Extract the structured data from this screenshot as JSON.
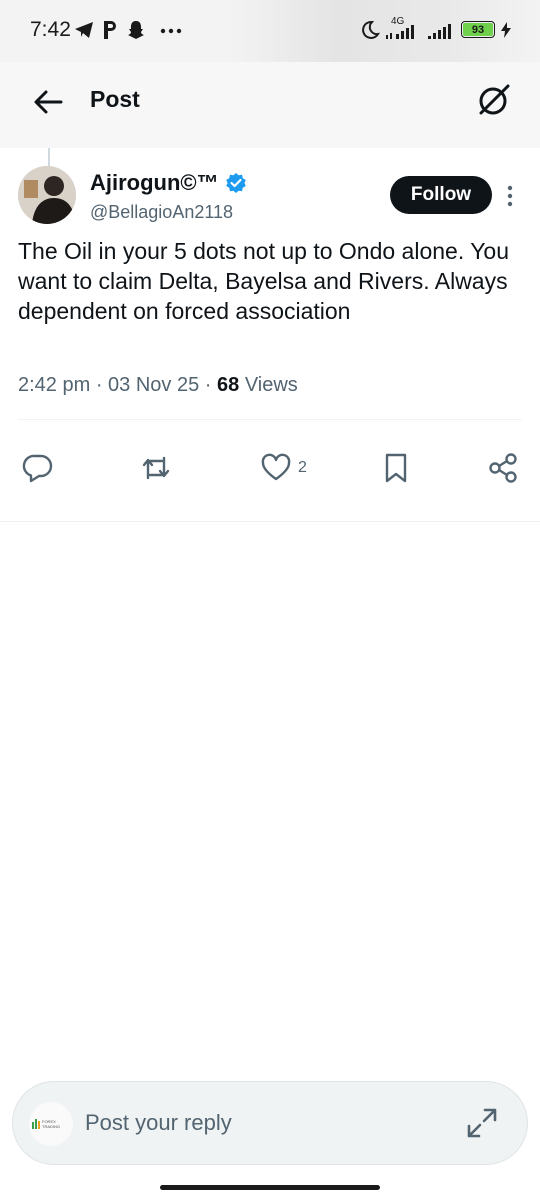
{
  "status_bar": {
    "time": "7:42",
    "network_label": "4G",
    "battery": "93"
  },
  "header": {
    "title": "Post"
  },
  "tweet": {
    "display_name": "Ajirogun©™",
    "handle": "@BellagioAn2118",
    "follow_label": "Follow",
    "text": "The Oil in your 5 dots not up to Ondo alone. You want to claim Delta, Bayelsa and Rivers. Always dependent on forced association",
    "time": "2:42 pm",
    "date": "03 Nov 25",
    "views_count": "68",
    "views_label": "Views",
    "likes_count": "2",
    "verified": true
  },
  "reply": {
    "placeholder": "Post your reply",
    "avatar_text": "FOREX TRADING"
  },
  "colors": {
    "text_primary": "#0f1419",
    "text_secondary": "#536471",
    "verified_blue": "#1d9bf0",
    "battery_green": "#6fd04b"
  },
  "icons": {
    "back": "arrow-left-icon",
    "grok": "grok-icon",
    "reply": "comment-icon",
    "repost": "repost-icon",
    "like": "heart-icon",
    "bookmark": "bookmark-icon",
    "share": "share-icon",
    "expand": "expand-icon"
  }
}
